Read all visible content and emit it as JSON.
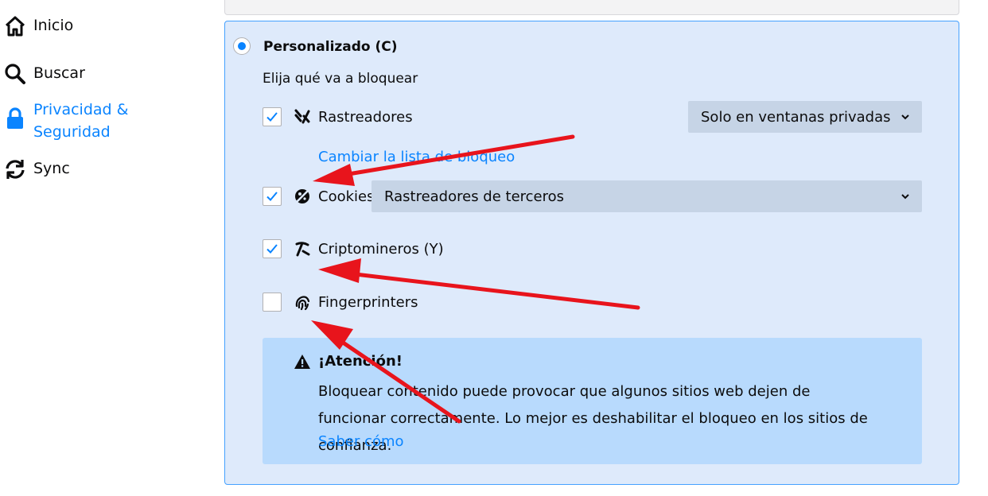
{
  "sidebar": {
    "items": [
      {
        "label": "Inicio",
        "icon": "home-icon"
      },
      {
        "label": "Buscar",
        "icon": "search-icon"
      },
      {
        "label": "Privacidad &",
        "label2": "Seguridad",
        "icon": "lock-icon",
        "selected": true
      },
      {
        "label": "Sync",
        "icon": "sync-icon"
      }
    ]
  },
  "custom": {
    "title": "Personalizado (C)",
    "subtitle": "Elija qué va a bloquear",
    "rows": {
      "trackers": {
        "label": "Rastreadores",
        "checked": true,
        "dropdown": "Solo en ventanas privadas",
        "link": "Cambiar la lista de bloqueo"
      },
      "cookies": {
        "label": "Cookies",
        "checked": true,
        "dropdown": "Rastreadores de terceros"
      },
      "cryptominers": {
        "label": "Criptomineros (Y)",
        "checked": true
      },
      "fingerprinters": {
        "label": "Fingerprinters",
        "checked": false
      }
    },
    "warning": {
      "title": "¡Atención!",
      "text": "Bloquear contenido puede provocar que algunos sitios web dejen de funcionar correctamente. Lo mejor es deshabilitar el bloqueo en los sitios de confianza.",
      "link": "Saber cómo"
    }
  },
  "colors": {
    "accent": "#0a84ff",
    "panel_bg": "#deeafb",
    "panel_border": "#45a1ff",
    "warning_bg": "#b8dafd",
    "annotation_arrow": "#e8141c"
  }
}
